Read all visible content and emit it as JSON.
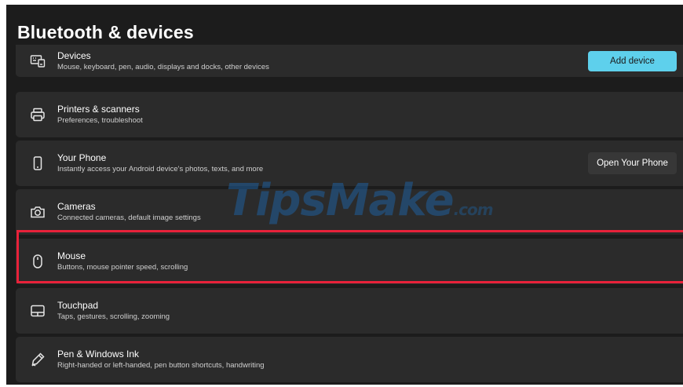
{
  "page": {
    "title": "Bluetooth & devices"
  },
  "items": [
    {
      "title": "Devices",
      "subtitle": "Mouse, keyboard, pen, audio, displays and docks, other devices",
      "icon": "devices-icon",
      "button": "Add device"
    },
    {
      "title": "Printers & scanners",
      "subtitle": "Preferences, troubleshoot",
      "icon": "printer-icon"
    },
    {
      "title": "Your Phone",
      "subtitle": "Instantly access your Android device's photos, texts, and more",
      "icon": "phone-icon",
      "button": "Open Your Phone"
    },
    {
      "title": "Cameras",
      "subtitle": "Connected cameras, default image settings",
      "icon": "camera-icon"
    },
    {
      "title": "Mouse",
      "subtitle": "Buttons, mouse pointer speed, scrolling",
      "icon": "mouse-icon",
      "highlighted": true
    },
    {
      "title": "Touchpad",
      "subtitle": "Taps, gestures, scrolling, zooming",
      "icon": "touchpad-icon"
    },
    {
      "title": "Pen & Windows Ink",
      "subtitle": "Right-handed or left-handed, pen button shortcuts, handwriting",
      "icon": "pen-icon"
    }
  ],
  "chevron": "›",
  "watermark": {
    "main": "TipsMake",
    "suffix": ".com"
  },
  "colors": {
    "background": "#1c1c1c",
    "card": "#2b2b2b",
    "accent": "#5ed0ec",
    "highlight": "#e8223a",
    "watermark": "#1f5f9c"
  }
}
